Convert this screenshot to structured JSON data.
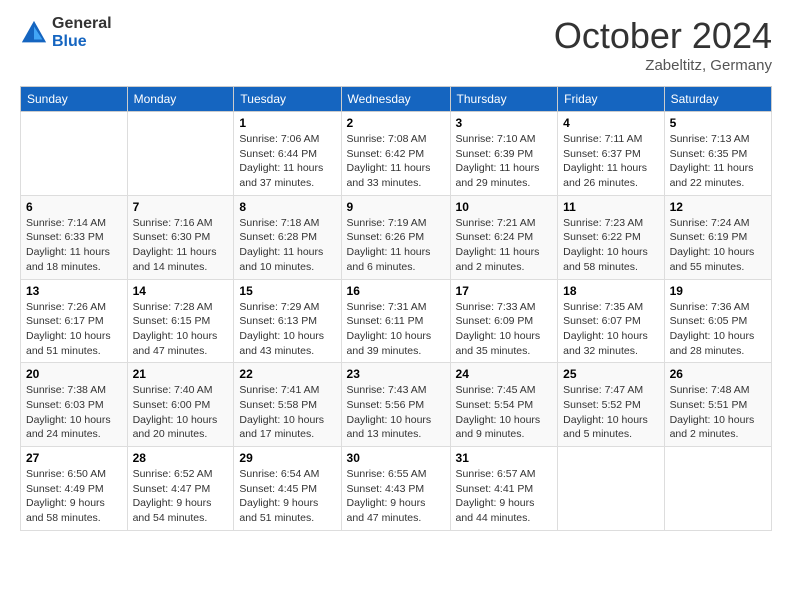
{
  "logo": {
    "general": "General",
    "blue": "Blue"
  },
  "title": "October 2024",
  "location": "Zabeltitz, Germany",
  "days_of_week": [
    "Sunday",
    "Monday",
    "Tuesday",
    "Wednesday",
    "Thursday",
    "Friday",
    "Saturday"
  ],
  "weeks": [
    [
      {
        "day": "",
        "info": ""
      },
      {
        "day": "",
        "info": ""
      },
      {
        "day": "1",
        "info": "Sunrise: 7:06 AM\nSunset: 6:44 PM\nDaylight: 11 hours and 37 minutes."
      },
      {
        "day": "2",
        "info": "Sunrise: 7:08 AM\nSunset: 6:42 PM\nDaylight: 11 hours and 33 minutes."
      },
      {
        "day": "3",
        "info": "Sunrise: 7:10 AM\nSunset: 6:39 PM\nDaylight: 11 hours and 29 minutes."
      },
      {
        "day": "4",
        "info": "Sunrise: 7:11 AM\nSunset: 6:37 PM\nDaylight: 11 hours and 26 minutes."
      },
      {
        "day": "5",
        "info": "Sunrise: 7:13 AM\nSunset: 6:35 PM\nDaylight: 11 hours and 22 minutes."
      }
    ],
    [
      {
        "day": "6",
        "info": "Sunrise: 7:14 AM\nSunset: 6:33 PM\nDaylight: 11 hours and 18 minutes."
      },
      {
        "day": "7",
        "info": "Sunrise: 7:16 AM\nSunset: 6:30 PM\nDaylight: 11 hours and 14 minutes."
      },
      {
        "day": "8",
        "info": "Sunrise: 7:18 AM\nSunset: 6:28 PM\nDaylight: 11 hours and 10 minutes."
      },
      {
        "day": "9",
        "info": "Sunrise: 7:19 AM\nSunset: 6:26 PM\nDaylight: 11 hours and 6 minutes."
      },
      {
        "day": "10",
        "info": "Sunrise: 7:21 AM\nSunset: 6:24 PM\nDaylight: 11 hours and 2 minutes."
      },
      {
        "day": "11",
        "info": "Sunrise: 7:23 AM\nSunset: 6:22 PM\nDaylight: 10 hours and 58 minutes."
      },
      {
        "day": "12",
        "info": "Sunrise: 7:24 AM\nSunset: 6:19 PM\nDaylight: 10 hours and 55 minutes."
      }
    ],
    [
      {
        "day": "13",
        "info": "Sunrise: 7:26 AM\nSunset: 6:17 PM\nDaylight: 10 hours and 51 minutes."
      },
      {
        "day": "14",
        "info": "Sunrise: 7:28 AM\nSunset: 6:15 PM\nDaylight: 10 hours and 47 minutes."
      },
      {
        "day": "15",
        "info": "Sunrise: 7:29 AM\nSunset: 6:13 PM\nDaylight: 10 hours and 43 minutes."
      },
      {
        "day": "16",
        "info": "Sunrise: 7:31 AM\nSunset: 6:11 PM\nDaylight: 10 hours and 39 minutes."
      },
      {
        "day": "17",
        "info": "Sunrise: 7:33 AM\nSunset: 6:09 PM\nDaylight: 10 hours and 35 minutes."
      },
      {
        "day": "18",
        "info": "Sunrise: 7:35 AM\nSunset: 6:07 PM\nDaylight: 10 hours and 32 minutes."
      },
      {
        "day": "19",
        "info": "Sunrise: 7:36 AM\nSunset: 6:05 PM\nDaylight: 10 hours and 28 minutes."
      }
    ],
    [
      {
        "day": "20",
        "info": "Sunrise: 7:38 AM\nSunset: 6:03 PM\nDaylight: 10 hours and 24 minutes."
      },
      {
        "day": "21",
        "info": "Sunrise: 7:40 AM\nSunset: 6:00 PM\nDaylight: 10 hours and 20 minutes."
      },
      {
        "day": "22",
        "info": "Sunrise: 7:41 AM\nSunset: 5:58 PM\nDaylight: 10 hours and 17 minutes."
      },
      {
        "day": "23",
        "info": "Sunrise: 7:43 AM\nSunset: 5:56 PM\nDaylight: 10 hours and 13 minutes."
      },
      {
        "day": "24",
        "info": "Sunrise: 7:45 AM\nSunset: 5:54 PM\nDaylight: 10 hours and 9 minutes."
      },
      {
        "day": "25",
        "info": "Sunrise: 7:47 AM\nSunset: 5:52 PM\nDaylight: 10 hours and 5 minutes."
      },
      {
        "day": "26",
        "info": "Sunrise: 7:48 AM\nSunset: 5:51 PM\nDaylight: 10 hours and 2 minutes."
      }
    ],
    [
      {
        "day": "27",
        "info": "Sunrise: 6:50 AM\nSunset: 4:49 PM\nDaylight: 9 hours and 58 minutes."
      },
      {
        "day": "28",
        "info": "Sunrise: 6:52 AM\nSunset: 4:47 PM\nDaylight: 9 hours and 54 minutes."
      },
      {
        "day": "29",
        "info": "Sunrise: 6:54 AM\nSunset: 4:45 PM\nDaylight: 9 hours and 51 minutes."
      },
      {
        "day": "30",
        "info": "Sunrise: 6:55 AM\nSunset: 4:43 PM\nDaylight: 9 hours and 47 minutes."
      },
      {
        "day": "31",
        "info": "Sunrise: 6:57 AM\nSunset: 4:41 PM\nDaylight: 9 hours and 44 minutes."
      },
      {
        "day": "",
        "info": ""
      },
      {
        "day": "",
        "info": ""
      }
    ]
  ]
}
